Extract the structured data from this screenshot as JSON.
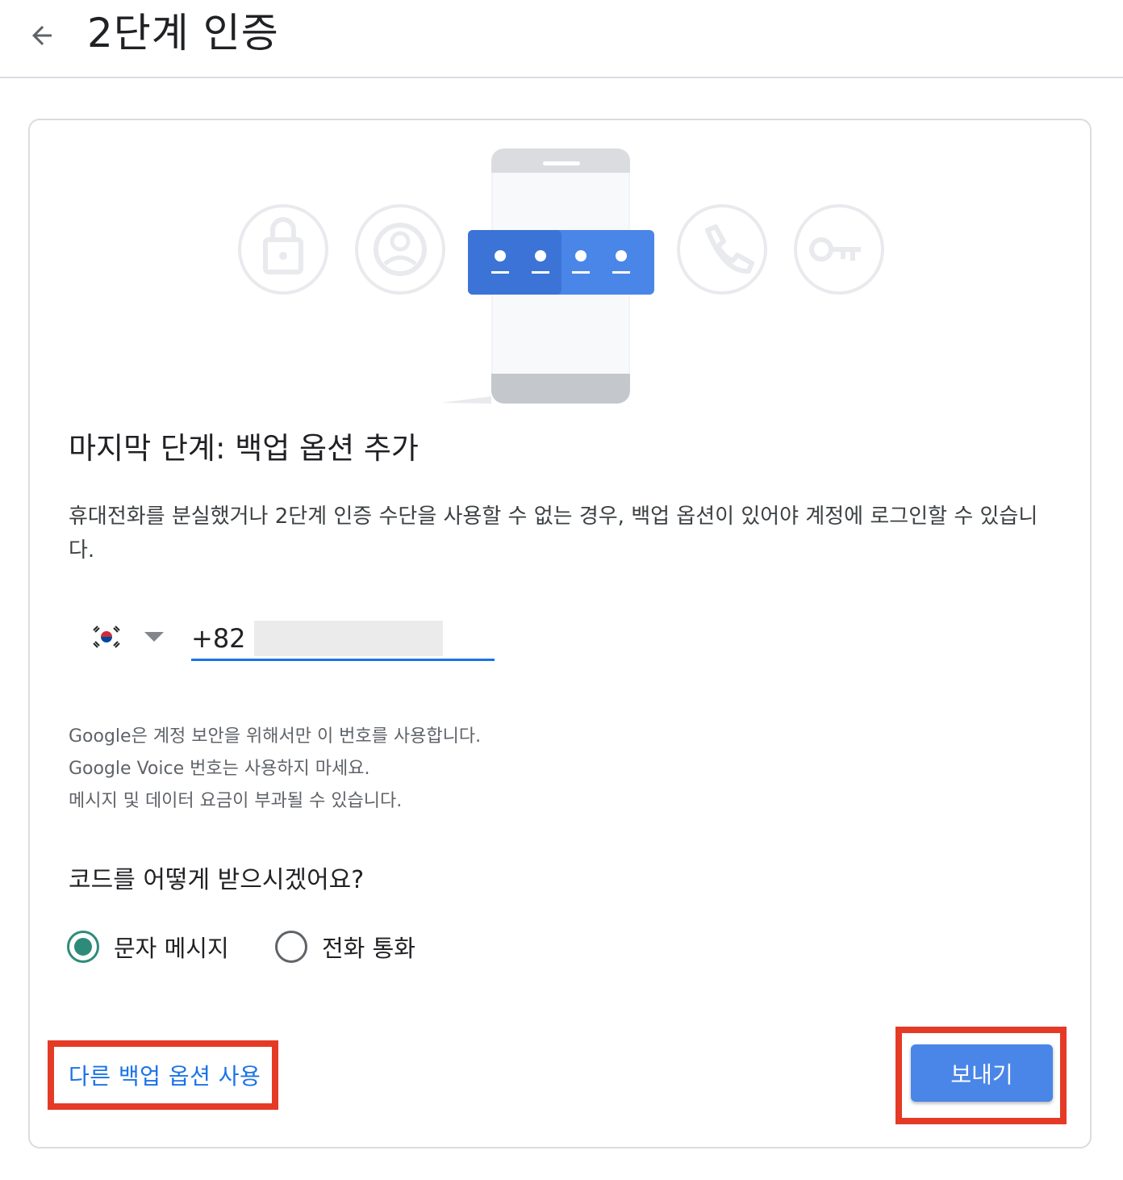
{
  "header": {
    "back_icon": "arrow-left-icon",
    "title": "2단계 인증"
  },
  "illustration": {
    "icons": [
      "lock-icon",
      "account-circle-icon",
      "phone-icon",
      "key-icon"
    ],
    "accent_color": "#4a86e8"
  },
  "section": {
    "title": "마지막 단계: 백업 옵션 추가",
    "description": "휴대전화를 분실했거나 2단계 인증 수단을 사용할 수 없는 경우, 백업 옵션이 있어야 계정에 로그인할 수 있습니다."
  },
  "phone": {
    "country_icon": "south-korea-flag-icon",
    "prefix": "+82"
  },
  "notices": [
    "Google은 계정 보안을 위해서만 이 번호를 사용합니다.",
    "Google Voice 번호는 사용하지 마세요.",
    "메시지 및 데이터 요금이 부과될 수 있습니다."
  ],
  "delivery": {
    "question": "코드를 어떻게 받으시겠어요?",
    "options": [
      {
        "label": "문자 메시지",
        "selected": true
      },
      {
        "label": "전화 통화",
        "selected": false
      }
    ]
  },
  "actions": {
    "alt_option": "다른 백업 옵션 사용",
    "send": "보내기"
  }
}
